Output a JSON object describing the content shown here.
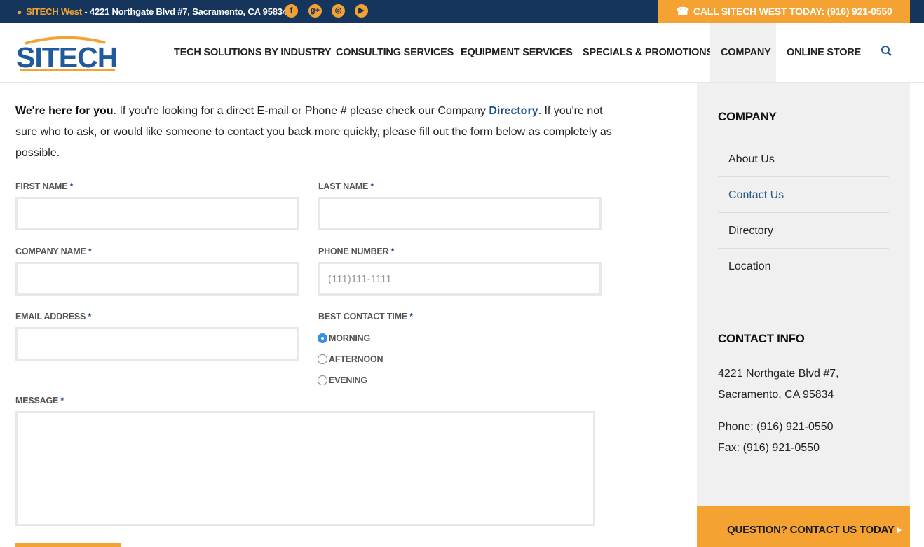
{
  "topbar": {
    "brand": "SITECH West",
    "address": " - 4221 Northgate Blvd #7, Sacramento, CA 95834",
    "social": [
      {
        "icon": "facebook-icon",
        "glyph": "f"
      },
      {
        "icon": "google-plus-icon",
        "glyph": "g+"
      },
      {
        "icon": "instagram-icon",
        "glyph": "◎"
      },
      {
        "icon": "youtube-icon",
        "glyph": "▶"
      }
    ],
    "call_label": "CALL SITECH WEST TODAY: (916) 921-0550"
  },
  "header": {
    "logo_text": "SITECH",
    "nav": [
      "TECH SOLUTIONS BY INDUSTRY",
      "CONSULTING SERVICES",
      "EQUIPMENT SERVICES",
      "SPECIALS & PROMOTIONS",
      "COMPANY",
      "ONLINE STORE"
    ]
  },
  "intro": {
    "bold": "We're here for you",
    "text1": ". If you're looking for a direct E-mail or Phone # please check our Company ",
    "link": "Directory",
    "text2": ". If you're not sure who to ask, or would like someone to contact you back more quickly, please fill out the form below as completely as possible."
  },
  "form": {
    "first_name": "FIRST NAME",
    "last_name": "LAST NAME",
    "company_name": "COMPANY NAME",
    "phone_number": "PHONE NUMBER",
    "phone_placeholder": "(111)111-1111",
    "email": "EMAIL ADDRESS",
    "best_time": "BEST CONTACT TIME",
    "times": [
      "MORNING",
      "AFTERNOON",
      "EVENING"
    ],
    "selected_time": "MORNING",
    "message": "MESSAGE",
    "required_mark": "*"
  },
  "sidebar": {
    "company_heading": "COMPANY",
    "items": [
      "About Us",
      "Contact Us",
      "Directory",
      "Location"
    ],
    "current": "Contact Us",
    "contact_heading": "CONTACT INFO",
    "address_line1": "4221 Northgate Blvd #7,",
    "address_line2": "Sacramento, CA 95834",
    "phone": "Phone: (916) 921-0550",
    "fax": "Fax: (916) 921-0550",
    "cta": "QUESTION? CONTACT US TODAY"
  },
  "colors": {
    "navy": "#16355c",
    "orange": "#f4a332",
    "link_blue": "#1d4f8c",
    "sidebar_bg": "#f0f0f0"
  }
}
